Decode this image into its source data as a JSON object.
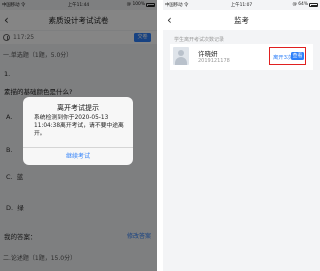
{
  "left": {
    "statusbar": {
      "carrier": "中国移动 令",
      "time": "上午11:44",
      "battery": "@ 100%"
    },
    "header": {
      "title": "素质设计考试试卷"
    },
    "timer": {
      "value": "117:25",
      "submit_label": "交卷"
    },
    "section1": {
      "title": "一.单选题（1题，5.0分）"
    },
    "question": {
      "number": "1.",
      "text": "素描的基础颜色是什么?",
      "options": [
        {
          "letter": "A",
          "text": ""
        },
        {
          "letter": "B",
          "text": ""
        },
        {
          "letter": "C",
          "text": "蓝"
        },
        {
          "letter": "D",
          "text": "绿"
        }
      ]
    },
    "answer": {
      "label": "我的答案：",
      "edit_label": "修改答案"
    },
    "section2": {
      "title": "二.论述题（1题，15.0分）"
    },
    "dialog": {
      "title": "离开考试提示",
      "body": "系统检测到你于2020-05-13 11:04:38离开考试，请不要中途离开。",
      "button_label": "继续考试"
    }
  },
  "right": {
    "statusbar": {
      "carrier": "中国移动 令",
      "time": "上午11:07",
      "battery": "@ 64%"
    },
    "header": {
      "title": "监考"
    },
    "record_label": "学生离开考试次数记录",
    "student": {
      "name": "许晓妍",
      "id": "2019121178",
      "leave_count": "离开3次",
      "view_label": "查看"
    },
    "colors": {
      "accent": "#2d7ff9",
      "highlight": "#e02020"
    }
  }
}
